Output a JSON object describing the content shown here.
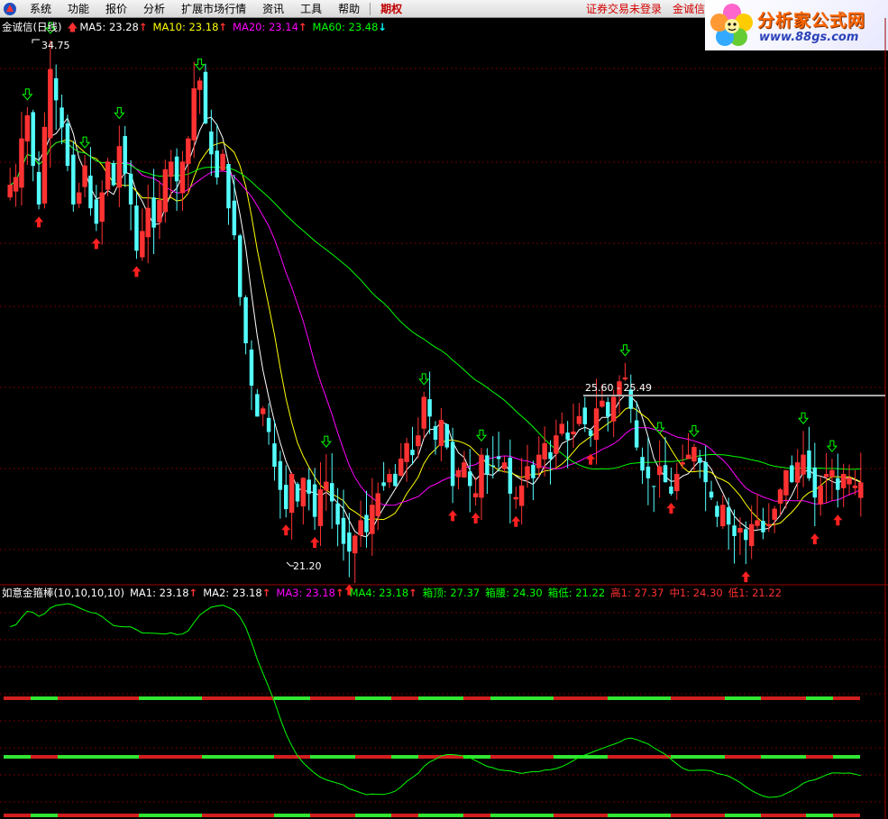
{
  "menu": {
    "items": [
      "系统",
      "功能",
      "报价",
      "分析",
      "扩展市场行情",
      "资讯",
      "工具",
      "帮助"
    ],
    "qiquan": "期权",
    "status_login": "证券交易未登录",
    "status_stock": "金诚信"
  },
  "watermark": {
    "text": "分析家公式网",
    "url": "www.88gs.com"
  },
  "main_panel": {
    "title": "金诚信(日线)",
    "indicators": [
      {
        "label": "MA5: 23.28",
        "arrow": "↑",
        "color": "#ffffff",
        "arrow_color": "#ff3030"
      },
      {
        "label": "MA10: 23.18",
        "arrow": "↑",
        "color": "#ffff00",
        "arrow_color": "#ff3030"
      },
      {
        "label": "MA20: 23.14",
        "arrow": "↑",
        "color": "#ff00ff",
        "arrow_color": "#ff3030"
      },
      {
        "label": "MA60: 23.48",
        "arrow": "↓",
        "color": "#00ff00",
        "arrow_color": "#00ffff"
      }
    ],
    "high_label": "34.75",
    "low_label": "21.20",
    "range_label": "25.60 - 25.49"
  },
  "sub_panel": {
    "title": "如意金箍棒(10,10,10,10)",
    "indicators": [
      {
        "label": "MA1: 23.18",
        "arrow": "↑",
        "color": "#ffffff",
        "arrow_color": "#ff3030"
      },
      {
        "label": "MA2: 23.18",
        "arrow": "↑",
        "color": "#ffff00",
        "arrow_color": "#ff3030"
      },
      {
        "label": "MA3: 23.18",
        "arrow": "↑",
        "color": "#ff00ff",
        "arrow_color": "#ff3030"
      },
      {
        "label": "MA4: 23.18",
        "arrow": "↑",
        "color": "#00ff00",
        "arrow_color": "#ff3030"
      },
      {
        "label": "箱顶: 27.37",
        "color": "#00ff00"
      },
      {
        "label": "箱腰: 24.30",
        "color": "#00ff00"
      },
      {
        "label": "箱低: 21.22",
        "color": "#00ff00"
      },
      {
        "label": "高1: 27.37",
        "color": "#ff3030"
      },
      {
        "label": "中1: 24.30",
        "color": "#ff3030"
      },
      {
        "label": "低1: 21.22",
        "color": "#ff3030"
      }
    ]
  },
  "colors": {
    "up": "#ff3232",
    "down": "#54ffff",
    "ma5": "#ffffff",
    "ma10": "#ffff00",
    "ma20": "#ff00ff",
    "ma60": "#00ff00"
  },
  "chart_data": {
    "type": "candlestick",
    "price_range": [
      21.2,
      34.75
    ],
    "closes": [
      31.0,
      31.2,
      32.2,
      32.8,
      31.5,
      30.5,
      32.5,
      34.0,
      33.2,
      32.5,
      31.5,
      30.5,
      30.8,
      31.5,
      30.4,
      30.0,
      30.8,
      31.6,
      31.0,
      32.0,
      31.3,
      30.5,
      29.3,
      29.8,
      30.4,
      29.9,
      30.6,
      31.4,
      31.6,
      31.1,
      31.6,
      32.2,
      33.5,
      33.7,
      32.6,
      31.8,
      31.2,
      31.8,
      30.4,
      29.7,
      28.1,
      26.9,
      25.8,
      25.0,
      25.2,
      24.6,
      23.7,
      23.1,
      22.6,
      23.5,
      22.8,
      23.4,
      23.0,
      22.4,
      23.1,
      23.3,
      22.8,
      22.2,
      21.7,
      21.5,
      21.9,
      22.3,
      22.0,
      22.7,
      23.0,
      23.2,
      23.5,
      23.2,
      23.9,
      24.3,
      24.0,
      24.5,
      25.5,
      25.0,
      24.4,
      24.9,
      24.2,
      23.2,
      23.6,
      23.8,
      23.2,
      23.0,
      24.0,
      23.5,
      23.7,
      23.9,
      23.8,
      23.0,
      22.9,
      23.2,
      23.7,
      23.4,
      24.0,
      24.3,
      23.9,
      24.5,
      24.8,
      24.4,
      24.6,
      25.0,
      24.8,
      24.5,
      25.2,
      25.4,
      25.0,
      25.5,
      25.9,
      26.0,
      25.2,
      24.2,
      23.6,
      23.4,
      23.2,
      23.7,
      23.3,
      23.0,
      23.5,
      23.8,
      24.0,
      24.2,
      23.8,
      23.3,
      22.9,
      22.4,
      22.7,
      22.2,
      21.9,
      22.1,
      21.8,
      22.2,
      22.3,
      22.0,
      22.2,
      22.6,
      23.1,
      23.6,
      23.3,
      23.8,
      24.0,
      23.4,
      22.9,
      23.2,
      23.5,
      23.6,
      23.1,
      23.5,
      23.4,
      23.2,
      23.28
    ]
  }
}
